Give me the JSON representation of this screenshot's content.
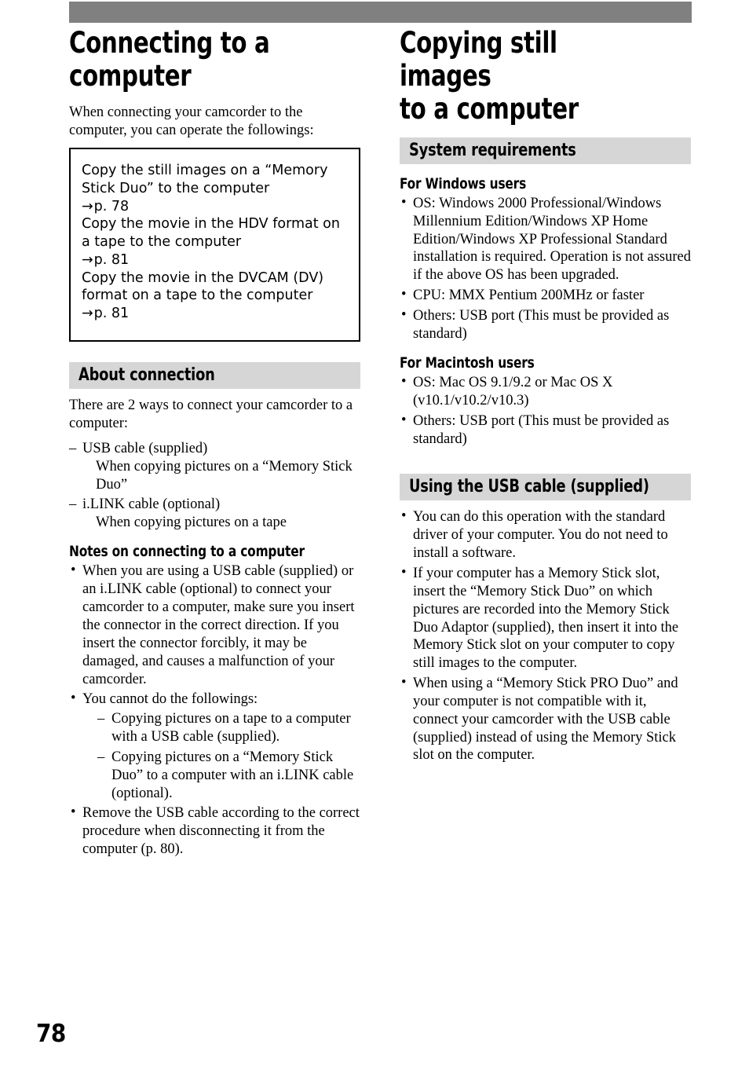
{
  "page": {
    "folio": "78",
    "top_bar_color": "#808080",
    "band_color": "#d6d6d6"
  },
  "left_column": {
    "chapter_title": "Connecting to a\ncomputer",
    "intro": "When connecting your camcorder to the computer, you can operate the followings:",
    "callout": {
      "entries": [
        {
          "text": "Copy the still images on a “Memory Stick Duo” to the computer",
          "arrow": "→",
          "ref": "p. 78"
        },
        {
          "text": "Copy the movie in the HDV format on a tape to the computer",
          "arrow": "→",
          "ref": "p. 81"
        },
        {
          "text": "Copy the movie in the DVCAM (DV) format on a tape to the computer",
          "arrow": "→",
          "ref": "p. 81"
        }
      ]
    },
    "about_connection": {
      "band_label": "About connection",
      "intro": "There are 2 ways to connect your camcorder to a computer:",
      "items": [
        {
          "dash": "–",
          "title": "USB cable (supplied)",
          "detail": "When copying pictures on a “Memory Stick Duo”"
        },
        {
          "dash": "–",
          "title": "i.LINK cable (optional)",
          "detail": "When copying pictures on a tape"
        }
      ]
    },
    "notes": {
      "heading": "Notes on connecting to a computer",
      "bullets": [
        {
          "bullet": "•",
          "text": "When you are using a USB cable (supplied) or an i.LINK cable (optional) to connect your camcorder to a computer, make sure you insert the connector in the correct direction. If you insert the connector forcibly, it may be damaged, and causes a malfunction of your camcorder."
        },
        {
          "bullet": "•",
          "text": "You cannot do the followings:",
          "sub_items": [
            {
              "dash": "–",
              "text": "Copying pictures on a tape to a computer with a USB cable (supplied)."
            },
            {
              "dash": "–",
              "text": "Copying pictures on a “Memory Stick Duo” to a computer with an i.LINK cable (optional)."
            }
          ]
        },
        {
          "bullet": "•",
          "text": "Remove the USB cable according to the correct procedure when disconnecting it from the computer (p. 80)."
        }
      ]
    }
  },
  "right_column": {
    "chapter_title": "Copying still images\nto a computer",
    "system_requirements": {
      "band_label": "System requirements",
      "windows": {
        "heading": "For Windows users",
        "bullets": [
          {
            "bullet": "•",
            "text": "OS: Windows 2000 Professional/Windows Millennium Edition/Windows XP Home Edition/Windows XP Professional Standard installation is required. Operation is not assured if the above OS has been upgraded."
          },
          {
            "bullet": "•",
            "text": "CPU: MMX Pentium 200MHz or faster"
          },
          {
            "bullet": "•",
            "text": "Others: USB port (This must be provided as standard)"
          }
        ]
      },
      "macintosh": {
        "heading": "For Macintosh users",
        "bullets": [
          {
            "bullet": "•",
            "text": "OS: Mac OS 9.1/9.2 or Mac OS X (v10.1/v10.2/v10.3)"
          },
          {
            "bullet": "•",
            "text": "Others: USB port (This must be provided as standard)"
          }
        ]
      }
    },
    "usb_cable": {
      "band_label": "Using the USB cable (supplied)",
      "bullets": [
        {
          "bullet": "•",
          "text": "You can do this operation with the standard driver of your computer. You do not need to install a software."
        },
        {
          "bullet": "•",
          "text": "If your computer has a Memory Stick slot, insert the “Memory Stick Duo” on which pictures are recorded into the Memory Stick Duo Adaptor (supplied), then insert it into the Memory Stick slot on your computer to copy still images to the computer."
        },
        {
          "bullet": "•",
          "text": "When using a “Memory Stick PRO Duo” and your computer is not compatible with it, connect your camcorder with the USB cable (supplied) instead of using the Memory Stick slot on the computer."
        }
      ]
    }
  }
}
